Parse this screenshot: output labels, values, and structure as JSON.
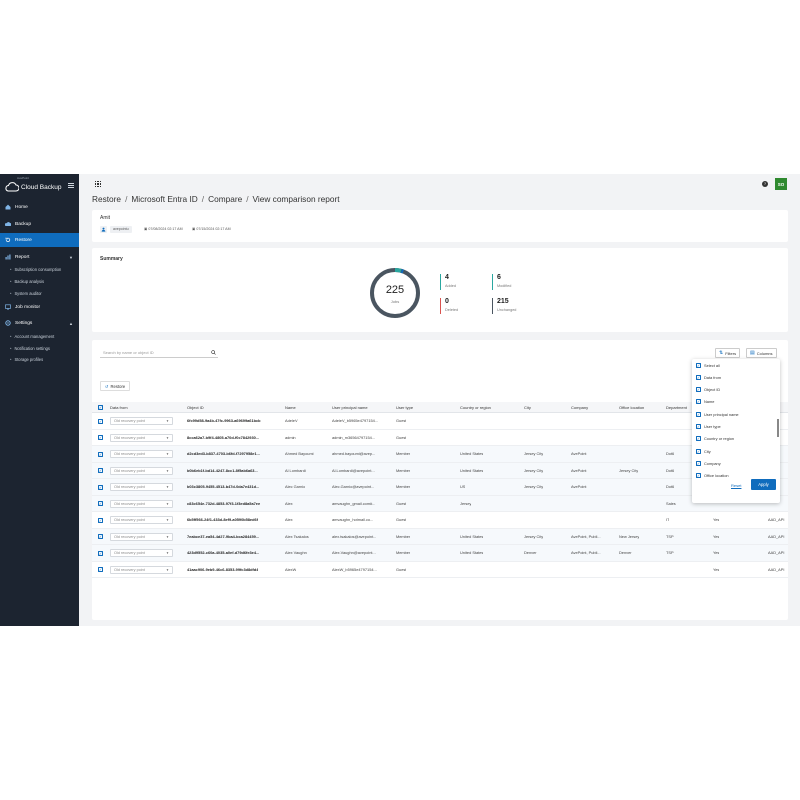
{
  "app": {
    "brand_sup": "AvePoint",
    "brand": "Cloud Backup",
    "user_initials": "SO"
  },
  "sidebar": {
    "items": [
      {
        "label": "Home"
      },
      {
        "label": "Backup"
      },
      {
        "label": "Restore"
      },
      {
        "label": "Report"
      },
      {
        "label": "Job monitor"
      },
      {
        "label": "Settings"
      }
    ],
    "report_sub": [
      "Subscription consumption",
      "Backup analysis",
      "System auditor"
    ],
    "settings_sub": [
      "Account management",
      "Notification settings",
      "Storage profiles"
    ]
  },
  "breadcrumb": [
    "Restore",
    "Microsoft Entra ID",
    "Compare",
    "View comparison report"
  ],
  "amit": {
    "name": "Amit",
    "chip_user": "avepointu",
    "chip_date1": "07/08/2024 02:17 AM",
    "chip_date2": "07/15/2024 02:17 AM"
  },
  "summary": {
    "title": "Summary",
    "total": "225",
    "total_label": "Jobs",
    "added": "4",
    "added_label": "Added",
    "modified": "6",
    "modified_label": "Modified",
    "deleted": "0",
    "deleted_label": "Deleted",
    "unchanged": "215",
    "unchanged_label": "Unchanged",
    "colors": {
      "added": "#2aa7a0",
      "modified": "#2aa7a0",
      "deleted": "#d9534f",
      "unchanged": "#4a5560",
      "ring": "#4a5560"
    }
  },
  "table": {
    "search_placeholder": "Search by name or object ID",
    "filters_label": "Filters",
    "columns_label": "Columns",
    "restore_label": "Restore",
    "headers": [
      "Data from",
      "Object ID",
      "Name",
      "User principal name",
      "User type",
      "Country or region",
      "City",
      "Company",
      "Office location",
      "Department"
    ],
    "rows": [
      {
        "data_from": "Old recovery point",
        "object_id": "6fc99d58-9a4b-47fc-9963-a69699a61bcb",
        "name": "AdeleV",
        "upn": "AdeleV_b5965e4797154...",
        "user_type": "Guest",
        "country": "",
        "city": "",
        "company": "",
        "office": "",
        "dept": "",
        "extra1": "",
        "extra2": "",
        "hl": false
      },
      {
        "data_from": "Old recovery point",
        "object_id": "8cca62a7-b9f4-4805-a70d-f0c7842930...",
        "name": "admin",
        "upn": "admin_m36564797154...",
        "user_type": "Guest",
        "country": "",
        "city": "",
        "company": "",
        "office": "",
        "dept": "",
        "extra1": "",
        "extra2": "",
        "hl": false
      },
      {
        "data_from": "Old recovery point",
        "object_id": "d2cd3ed3-b837-4703-b6fd-f7297958e1...",
        "name": "Ahmed Bayoumi",
        "upn": "ahmed.bayoumi@avep...",
        "user_type": "Member",
        "country": "United States",
        "city": "Jersey City",
        "company": "AvePoint",
        "office": "",
        "dept": "Dot6",
        "extra1": "",
        "extra2": "",
        "hl": true
      },
      {
        "data_from": "Old recovery point",
        "object_id": "b0b6eb1f-bd14-4247-8cc1-8f5ab6a63...",
        "name": "Al Lombardi",
        "upn": "Al.Lombardi@avepoint...",
        "user_type": "Member",
        "country": "United States",
        "city": "Jersey City",
        "company": "AvePoint",
        "office": "Jersey City",
        "dept": "Dot6",
        "extra1": "",
        "extra2": "",
        "hl": true
      },
      {
        "data_from": "Old recovery point",
        "object_id": "b03c3805-9455-4513-b47d-0da7e431d...",
        "name": "Alec Garnio",
        "upn": "Alec.Garnio@avepoint...",
        "user_type": "Member",
        "country": "US",
        "city": "Jersey City",
        "company": "AvePoint",
        "office": "",
        "dept": "Dot6",
        "extra1": "",
        "extra2": "",
        "hl": true
      },
      {
        "data_from": "Old recovery point",
        "object_id": "c83c654e-732d-4853-97f3-1f3ed8a5a7ee",
        "name": "Alex",
        "upn": "amvaughn_gmail.com#...",
        "user_type": "Guest",
        "country": "Jersey",
        "city": "",
        "company": "",
        "office": "",
        "dept": "Sales",
        "extra1": "",
        "extra2": "",
        "hl": true
      },
      {
        "data_from": "Old recovery point",
        "object_id": "6b5ff566-24f1-433d-8ef9-a0590b58ed6f",
        "name": "Alex",
        "upn": "amvaughn_hotmail.co...",
        "user_type": "Guest",
        "country": "",
        "city": "",
        "company": "",
        "office": "",
        "dept": "IT",
        "extra1": "Yes",
        "extra2": "AAD_API",
        "hl": false
      },
      {
        "data_from": "Old recovery point",
        "object_id": "7eabce37-ea54-4d27-9ba4-bca284459...",
        "name": "Alex Tsakalos",
        "upn": "alex.tsakalos@avepoint...",
        "user_type": "Member",
        "country": "United States",
        "city": "Jersey City",
        "company": "AvePoint, Publi...",
        "office": "New Jersey",
        "dept": "TSP",
        "extra1": "Yes",
        "extra2": "AAD_API",
        "hl": true
      },
      {
        "data_from": "Old recovery point",
        "object_id": "423d9552-c60a-4035-a0ef-d79d6fe3e4...",
        "name": "Alex Vaughn",
        "upn": "Alex.Vaughn@avepoint...",
        "user_type": "Member",
        "country": "United States",
        "city": "Denver",
        "company": "AvePoint, Publi...",
        "office": "Denver",
        "dept": "TSP",
        "extra1": "Yes",
        "extra2": "AAD_API",
        "hl": true
      },
      {
        "data_from": "Old recovery point",
        "object_id": "41aac906-9eb9-46c6-8353-99fc3d8dfd4",
        "name": "AlexW",
        "upn": "AlexW_b5965e4797154...",
        "user_type": "Guest",
        "country": "",
        "city": "",
        "company": "",
        "office": "",
        "dept": "",
        "extra1": "Yes",
        "extra2": "AAD_API",
        "hl": false
      }
    ]
  },
  "columns_menu": {
    "items": [
      "Select all",
      "Data from",
      "Object ID",
      "Name",
      "User principal name",
      "User type",
      "Country or region",
      "City",
      "Company",
      "Office location"
    ],
    "reset_label": "Reset",
    "apply_label": "Apply"
  }
}
